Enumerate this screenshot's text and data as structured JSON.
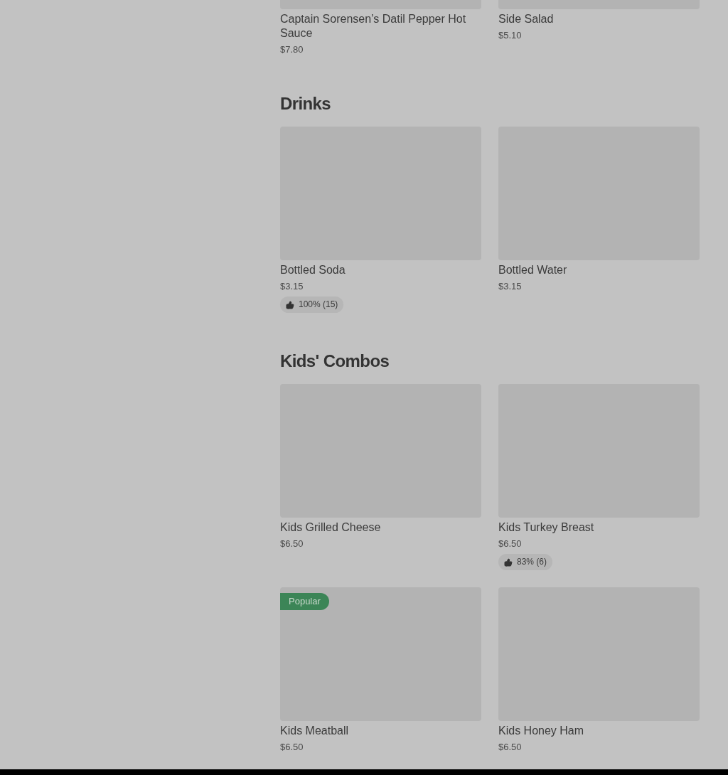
{
  "sections": [
    {
      "image_cropped": true,
      "items": [
        {
          "name": "Captain Sorensen’s Datil Pepper Hot Sauce",
          "price": "$7.80"
        },
        {
          "name": "Side Salad",
          "price": "$5.10"
        }
      ]
    },
    {
      "title": "Drinks",
      "items": [
        {
          "name": "Bottled Soda",
          "price": "$3.15",
          "rating": "100% (15)"
        },
        {
          "name": "Bottled Water",
          "price": "$3.15"
        }
      ]
    },
    {
      "title": "Kids' Combos",
      "items": [
        {
          "name": "Kids Grilled Cheese",
          "price": "$6.50"
        },
        {
          "name": "Kids Turkey Breast",
          "price": "$6.50",
          "rating": "83% (6)"
        },
        {
          "name": "Kids Meatball",
          "price": "$6.50",
          "badge": "Popular"
        },
        {
          "name": "Kids Honey Ham",
          "price": "$6.50"
        }
      ]
    }
  ]
}
